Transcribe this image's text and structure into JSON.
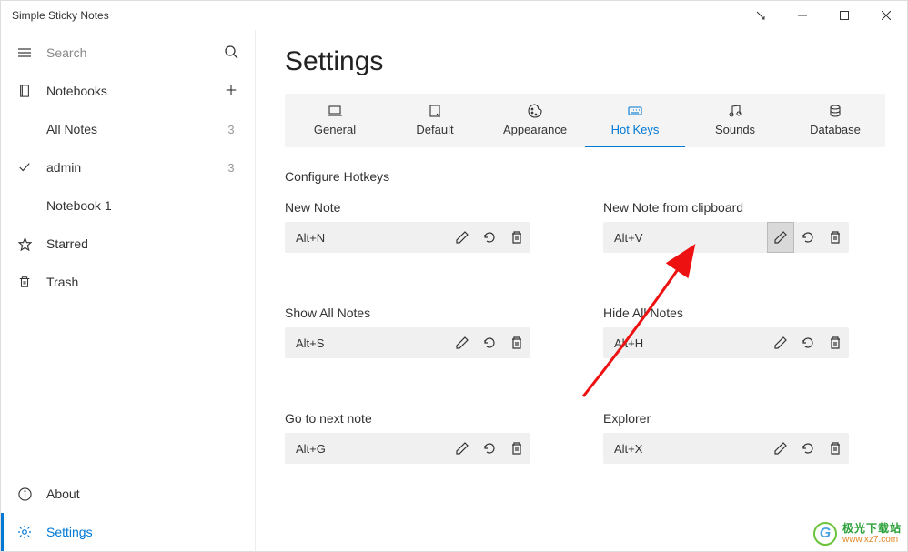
{
  "window": {
    "title": "Simple Sticky Notes"
  },
  "sidebar": {
    "search_placeholder": "Search",
    "notebooks_label": "Notebooks",
    "items": [
      {
        "label": "All Notes",
        "count": "3"
      },
      {
        "label": "admin",
        "count": "3"
      },
      {
        "label": "Notebook 1",
        "count": ""
      }
    ],
    "starred_label": "Starred",
    "trash_label": "Trash",
    "about_label": "About",
    "settings_label": "Settings"
  },
  "page": {
    "title": "Settings",
    "section_label": "Configure Hotkeys"
  },
  "tabs": [
    {
      "label": "General"
    },
    {
      "label": "Default"
    },
    {
      "label": "Appearance"
    },
    {
      "label": "Hot Keys"
    },
    {
      "label": "Sounds"
    },
    {
      "label": "Database"
    }
  ],
  "hotkeys": [
    {
      "label": "New Note",
      "value": "Alt+N"
    },
    {
      "label": "New Note from clipboard",
      "value": "Alt+V"
    },
    {
      "label": "Show All Notes",
      "value": "Alt+S"
    },
    {
      "label": "Hide All Notes",
      "value": "Alt+H"
    },
    {
      "label": "Go to next note",
      "value": "Alt+G"
    },
    {
      "label": "Explorer",
      "value": "Alt+X"
    }
  ],
  "watermark": {
    "line1": "极光下载站",
    "line2": "www.xz7.com"
  }
}
